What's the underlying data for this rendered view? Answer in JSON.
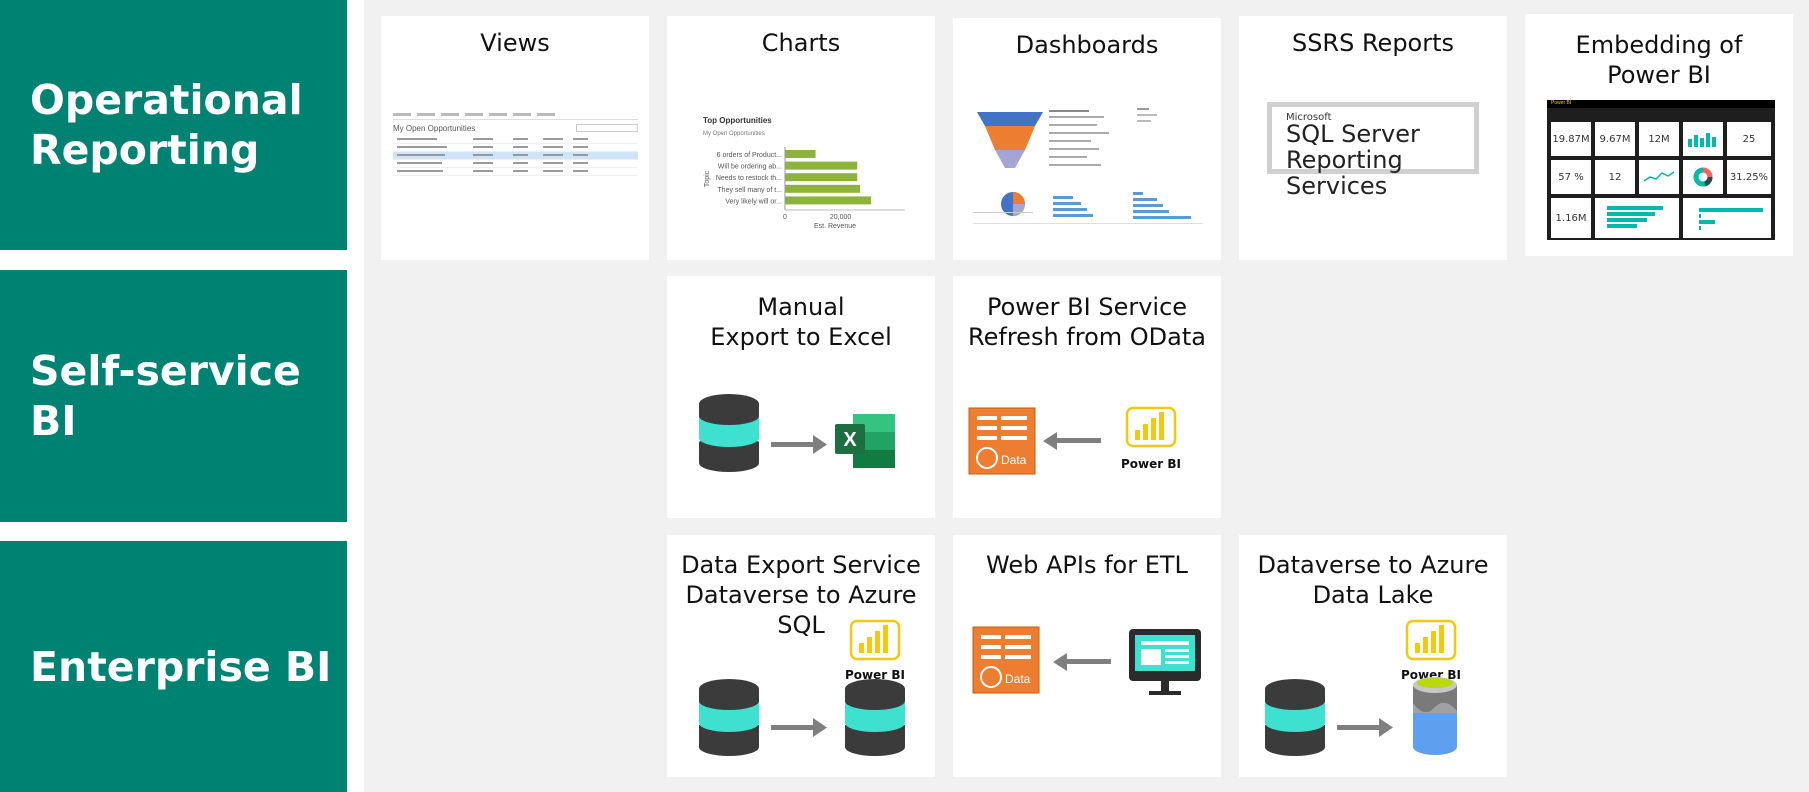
{
  "rows": [
    {
      "label": "Operational\nReporting"
    },
    {
      "label": "Self-service BI"
    },
    {
      "label": "Enterprise BI"
    }
  ],
  "cards": {
    "views": {
      "title": "Views",
      "list_title": "My Open Opportunities"
    },
    "charts": {
      "title": "Charts",
      "chart_title": "Top Opportunities",
      "chart_subtitle": "My Open Opportunities",
      "chart_data": {
        "type": "bar",
        "title": "Top Opportunities",
        "subtitle": "My Open Opportunities",
        "categories": [
          "6 orders of Product...",
          "Will be ordering ab...",
          "Needs to restock th...",
          "They sell many of t...",
          "Very likely will or..."
        ],
        "values": [
          11000,
          26000,
          26000,
          27000,
          31000
        ],
        "xlabel": "Est. Revenue",
        "ylabel": "Topic",
        "x_ticks": [
          "0",
          "20,000"
        ],
        "xlim": [
          0,
          36000
        ],
        "color": "#8db33a"
      }
    },
    "dashboards": {
      "title": "Dashboards"
    },
    "ssrs": {
      "title": "SSRS Reports",
      "logo_brand": "Microsoft",
      "logo_text": "SQL Server\nReporting Services"
    },
    "embedding": {
      "title": "Embedding of\nPower BI",
      "app_name": "Power BI",
      "kpis": [
        "19.87M",
        "9.67M",
        "12M",
        "25",
        "57 %",
        "12",
        "31.25%",
        "1.16M"
      ]
    },
    "manual_export": {
      "title": "Manual\nExport to Excel",
      "excel_letter": "X"
    },
    "odata_refresh": {
      "title": "Power BI Service\nRefresh from OData",
      "data_label": "Data",
      "powerbi_caption": "Power BI"
    },
    "data_export": {
      "title": "Data Export Service\nDataverse to Azure\nSQL",
      "powerbi_caption": "Power BI"
    },
    "web_apis": {
      "title": "Web APIs for ETL",
      "data_label": "Data"
    },
    "data_lake": {
      "title": "Dataverse to Azure\nData Lake",
      "powerbi_caption": "Power BI"
    }
  },
  "colors": {
    "row_label_bg": "#008272",
    "grid_bg": "#f1f1f1",
    "accent_orange": "#ed7d31",
    "db_teal": "#3ee0d0",
    "db_dark": "#3b3b3b",
    "powerbi_yellow": "#f2c811",
    "excel_green": "#1d6f42"
  }
}
